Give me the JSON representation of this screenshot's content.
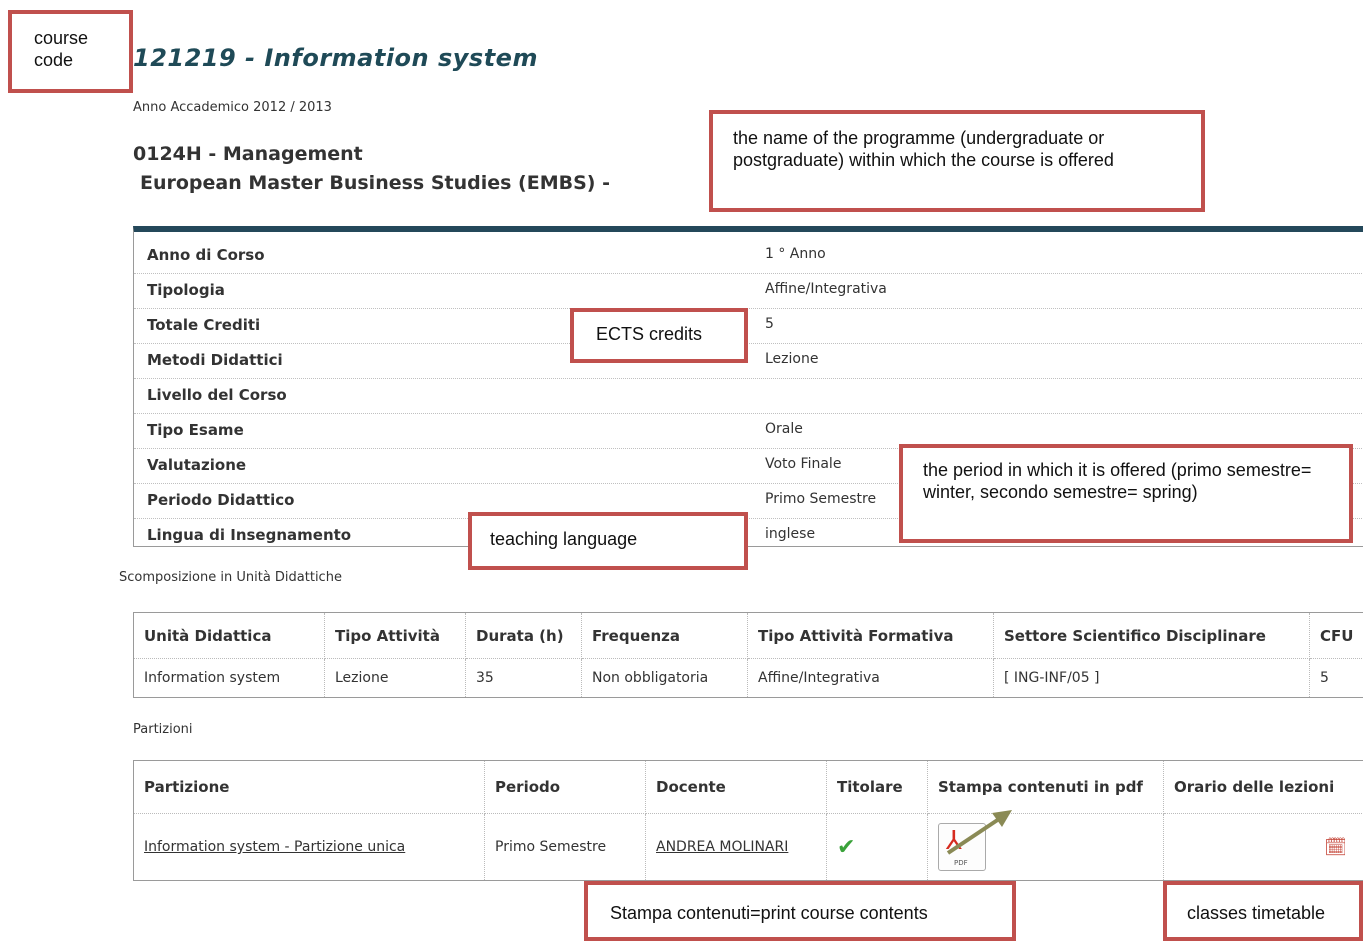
{
  "course": {
    "code_title": "121219  -  Information system",
    "academic_year": "Anno Accademico 2012 / 2013"
  },
  "programme": {
    "line1": "0124H - Management",
    "line2": "European Master Business Studies (EMBS) -"
  },
  "info": [
    {
      "label": "Anno di Corso",
      "value": "1 °  Anno"
    },
    {
      "label": "Tipologia",
      "value": "Affine/Integrativa"
    },
    {
      "label": "Totale Crediti",
      "value": "5"
    },
    {
      "label": "Metodi Didattici",
      "value": "Lezione"
    },
    {
      "label": "Livello del Corso",
      "value": ""
    },
    {
      "label": "Tipo Esame",
      "value": "Orale"
    },
    {
      "label": "Valutazione",
      "value": "Voto Finale"
    },
    {
      "label": "Periodo Didattico",
      "value": "Primo Semestre"
    },
    {
      "label": "Lingua di Insegnamento",
      "value": "inglese"
    }
  ],
  "units_section": {
    "title": "Scomposizione in Unità Didattiche",
    "headers": [
      "Unità Didattica",
      "Tipo Attività",
      "Durata (h)",
      "Frequenza",
      "Tipo Attività Formativa",
      "Settore Scientifico Disciplinare",
      "CFU"
    ],
    "rows": [
      [
        "Information system",
        "Lezione",
        "35",
        "Non obbligatoria",
        "Affine/Integrativa",
        "[ ING-INF/05 ]",
        "5"
      ]
    ]
  },
  "partitions": {
    "title": "Partizioni",
    "headers": [
      "Partizione",
      "Periodo",
      "Docente",
      "Titolare",
      "Stampa contenuti in pdf",
      "Orario delle lezioni"
    ],
    "row": {
      "partizione": "Information system - Partizione unica",
      "periodo": "Primo Semestre",
      "docente": "ANDREA MOLINARI"
    },
    "icons": [
      "check-icon",
      "pdf-icon",
      "timetable-icon"
    ]
  },
  "annotations": {
    "course_code": "course code",
    "programme": "the name of the programme (undergraduate or postgraduate) within which the course is offered",
    "ects": "ECTS credits",
    "period": "the period in which it is offered (primo semestre= winter, secondo semestre= spring)",
    "language": "teaching language",
    "print": "Stampa contenuti=print course contents",
    "timetable": "classes timetable"
  },
  "colors": {
    "title": "#1f4a57",
    "header_bar": "#24485a",
    "annotation_border": "#c0504d",
    "arrow": "#8a8a55"
  }
}
